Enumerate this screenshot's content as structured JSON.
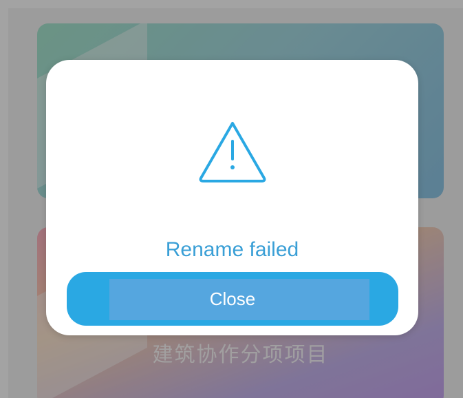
{
  "background": {
    "bottom_card_text": "建筑协作分项项目"
  },
  "dialog": {
    "icon": "warning-triangle-icon",
    "message": "Rename failed",
    "close_label": "Close"
  },
  "colors": {
    "accent": "#2aa8e3",
    "message_text": "#3a9fd6",
    "overlay": "rgba(0,0,0,0.36)"
  }
}
